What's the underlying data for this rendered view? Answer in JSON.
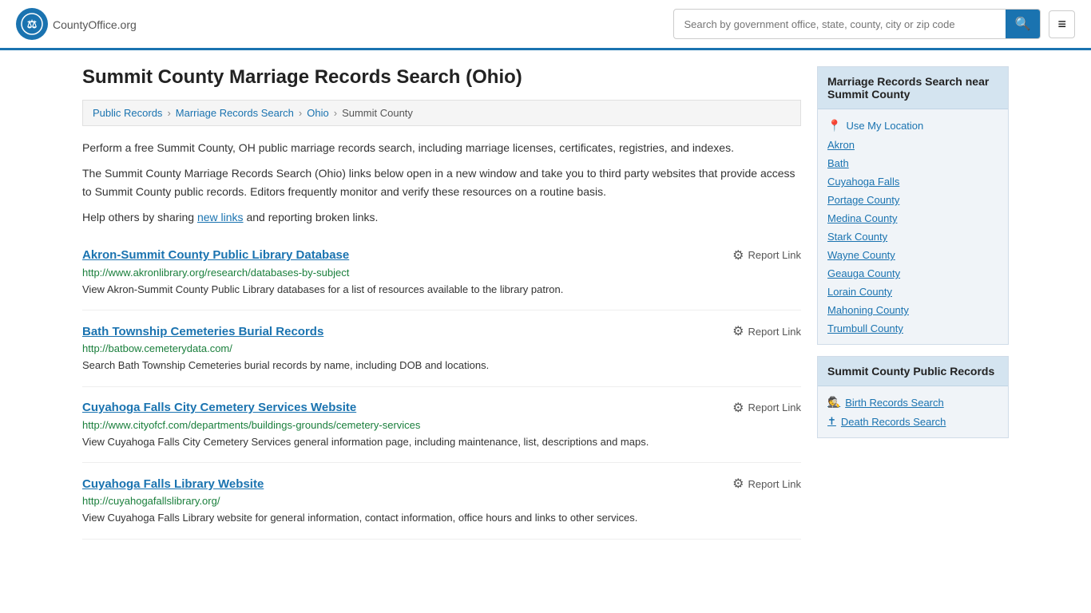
{
  "header": {
    "logo_text": "CountyOffice",
    "logo_suffix": ".org",
    "search_placeholder": "Search by government office, state, county, city or zip code",
    "search_button_icon": "🔍"
  },
  "page": {
    "title": "Summit County Marriage Records Search (Ohio)",
    "breadcrumb": [
      {
        "label": "Public Records",
        "href": "#"
      },
      {
        "label": "Marriage Records Search",
        "href": "#"
      },
      {
        "label": "Ohio",
        "href": "#"
      },
      {
        "label": "Summit County",
        "href": "#"
      }
    ],
    "description1": "Perform a free Summit County, OH public marriage records search, including marriage licenses, certificates, registries, and indexes.",
    "description2": "The Summit County Marriage Records Search (Ohio) links below open in a new window and take you to third party websites that provide access to Summit County public records. Editors frequently monitor and verify these resources on a routine basis.",
    "description3_prefix": "Help others by sharing ",
    "description3_link": "new links",
    "description3_suffix": " and reporting broken links.",
    "records": [
      {
        "title": "Akron-Summit County Public Library Database",
        "url": "http://www.akronlibrary.org/research/databases-by-subject",
        "desc": "View Akron-Summit County Public Library databases for a list of resources available to the library patron."
      },
      {
        "title": "Bath Township Cemeteries Burial Records",
        "url": "http://batbow.cemeterydata.com/",
        "desc": "Search Bath Township Cemeteries burial records by name, including DOB and locations."
      },
      {
        "title": "Cuyahoga Falls City Cemetery Services Website",
        "url": "http://www.cityofcf.com/departments/buildings-grounds/cemetery-services",
        "desc": "View Cuyahoga Falls City Cemetery Services general information page, including maintenance, list, descriptions and maps."
      },
      {
        "title": "Cuyahoga Falls Library Website",
        "url": "http://cuyahogafallslibrary.org/",
        "desc": "View Cuyahoga Falls Library website for general information, contact information, office hours and links to other services."
      }
    ],
    "report_label": "Report Link"
  },
  "sidebar": {
    "nearby_section": {
      "title": "Marriage Records Search near Summit County",
      "use_location": "Use My Location",
      "links": [
        "Akron",
        "Bath",
        "Cuyahoga Falls",
        "Portage County",
        "Medina County",
        "Stark County",
        "Wayne County",
        "Geauga County",
        "Lorain County",
        "Mahoning County",
        "Trumbull County"
      ]
    },
    "public_records_section": {
      "title": "Summit County Public Records",
      "links": [
        {
          "label": "Birth Records Search",
          "icon": "🕵"
        },
        {
          "label": "Death Records Search",
          "icon": "✝"
        }
      ]
    }
  }
}
